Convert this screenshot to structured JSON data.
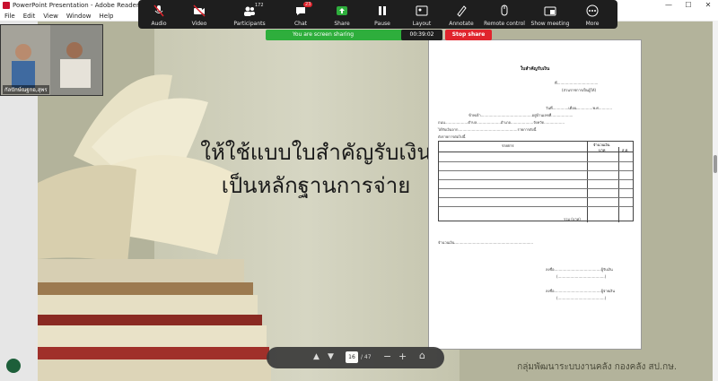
{
  "titlebar": {
    "title": "PowerPoint Presentation - Adobe Reader",
    "minimize": "—",
    "maximize": "☐",
    "close": "✕"
  },
  "menu": [
    "File",
    "Edit",
    "View",
    "Window",
    "Help"
  ],
  "zoom_toolbar": {
    "items": [
      {
        "label": "Audio",
        "icon": "mic-muted-icon"
      },
      {
        "label": "Video",
        "icon": "video-off-icon"
      },
      {
        "label": "Participants",
        "icon": "participants-icon",
        "count": "172"
      },
      {
        "label": "Chat",
        "icon": "chat-icon",
        "badge": "23"
      },
      {
        "label": "Share",
        "icon": "share-icon"
      },
      {
        "label": "Pause",
        "icon": "pause-icon"
      },
      {
        "label": "Layout",
        "icon": "layout-icon"
      },
      {
        "label": "Annotate",
        "icon": "annotate-icon"
      },
      {
        "label": "Remote control",
        "icon": "remote-control-icon"
      },
      {
        "label": "Show meeting",
        "icon": "show-meeting-icon"
      },
      {
        "label": "More",
        "icon": "more-icon"
      }
    ]
  },
  "share_bar": {
    "text": "You are screen sharing",
    "timer": "00:39:02",
    "stop": "Stop share"
  },
  "video_thumb": {
    "name": "กัลปักษ์ณฐกอ,สุพร"
  },
  "slide": {
    "title_line1": "ให้ใช้แบบใบสำคัญรับเงิน",
    "title_line2": "เป็นหลักฐานการจ่าย",
    "footer": "กลุ่มพัฒนาระบบงานคลัง กองคลัง สป.กษ."
  },
  "doc": {
    "title": "ใบสำคัญรับเงิน",
    "line_no": "ที่....................................",
    "line_note": "(ส่วนราชการเป็นผู้ให้)",
    "line_date": "วันที่..............เดือน..............พ.ศ............",
    "line_name": "ข้าพเจ้า.............................................อยู่บ้านเลขที่...................",
    "line_addr": "ถนน....................ตำบล.....................อำเภอ....................จังหวัด..................",
    "line_recv": "ได้รับเงินจาก....................................................รายการดังนี้",
    "line_detail": "ดังรายการต่อไปนี้",
    "col_item": "รายการ",
    "col_amount": "จำนวนเงิน",
    "col_baht": "บาท",
    "col_satang": "ส.ต.",
    "total": "รวม (บาท)",
    "amount_words": "จำนวนเงิน.....................................................................",
    "sign1": "ลงชื่อ.........................................ผู้รับเงิน",
    "sign1_paren": "(.........................................)",
    "sign2": "ลงชื่อ.........................................ผู้จ่ายเงิน",
    "sign2_paren": "(.........................................)"
  },
  "pdf_nav": {
    "page": "16",
    "total": "/ 47"
  },
  "colors": {
    "zoom_bg": "#1e1e1e",
    "share_green": "#2eae3c",
    "stop_red": "#e0242d",
    "slide_bg": "#b3b39b"
  }
}
